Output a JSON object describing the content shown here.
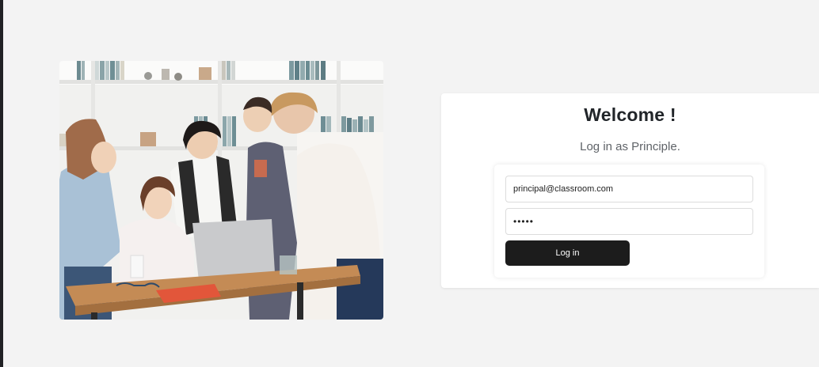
{
  "login": {
    "title": "Welcome !",
    "subtitle": "Log in as Principle.",
    "email_value": "principal@classroom.com",
    "password_value": "•••••",
    "button_label": "Log in"
  },
  "colors": {
    "background": "#f3f3f3",
    "card": "#ffffff",
    "button": "#1c1c1c",
    "button_text": "#ffffff"
  }
}
